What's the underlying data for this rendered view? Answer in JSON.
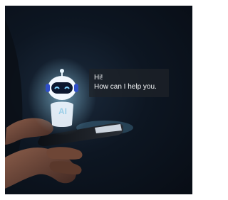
{
  "image": {
    "chat_bubble": {
      "line1": "Hi!",
      "line2": "How can I help you."
    },
    "robot": {
      "chest_label": "AI",
      "icon": "robot-icon"
    },
    "colors": {
      "background": "#0b121c",
      "glow": "#7fd3ff",
      "bubble": "#1e2228"
    }
  }
}
